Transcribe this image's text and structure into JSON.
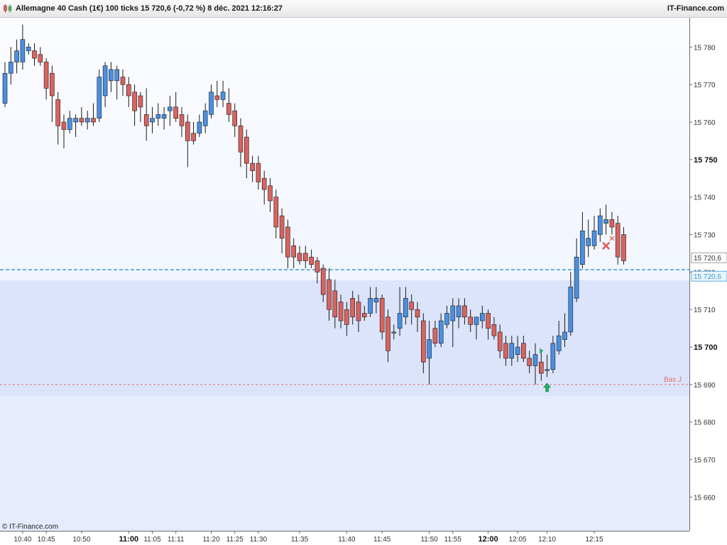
{
  "header": {
    "title": "Allemagne 40 Cash (1€) 100 ticks 15 720,6 (-0,72 %) 8 déc. 2021 12:16:27",
    "brand": "IT-Finance.com",
    "credit": "© IT-Finance.com"
  },
  "colors": {
    "up": "#4a90e2",
    "down": "#d9635f",
    "price_line": "#3a9ad9",
    "bas_j": "#e07070",
    "signal_buy": "#27ae60",
    "signal_exit": "#e05555"
  },
  "chart_data": {
    "type": "candlestick",
    "ylim": [
      15651,
      15788
    ],
    "y_ticks": [
      15660,
      15670,
      15680,
      15690,
      15700,
      15710,
      15720,
      15730,
      15740,
      15750,
      15760,
      15770,
      15780
    ],
    "y_tick_labels": [
      "15 660",
      "15 670",
      "15 680",
      "15 690",
      "15 700",
      "15 710",
      "15 720",
      "15 730",
      "15 740",
      "15 750",
      "15 760",
      "15 770",
      "15 780"
    ],
    "y_bold_ticks": [
      15700,
      15750
    ],
    "last_price": 15720.6,
    "last_price_label": "15 720,6",
    "bas_j": 15690,
    "bas_j_label": "Bas J",
    "x_labels": [
      {
        "label": "10:40",
        "bar": 3
      },
      {
        "label": "10:45",
        "bar": 7
      },
      {
        "label": "10:50",
        "bar": 13
      },
      {
        "label": "11:00",
        "bar": 21,
        "bold": true
      },
      {
        "label": "11:05",
        "bar": 25
      },
      {
        "label": "11:11",
        "bar": 29
      },
      {
        "label": "11:20",
        "bar": 35
      },
      {
        "label": "11:25",
        "bar": 39
      },
      {
        "label": "11:30",
        "bar": 43
      },
      {
        "label": "11:35",
        "bar": 50
      },
      {
        "label": "11:40",
        "bar": 58
      },
      {
        "label": "11:45",
        "bar": 64
      },
      {
        "label": "11:50",
        "bar": 72
      },
      {
        "label": "11:55",
        "bar": 76
      },
      {
        "label": "12:00",
        "bar": 82,
        "bold": true
      },
      {
        "label": "12:05",
        "bar": 87
      },
      {
        "label": "12:10",
        "bar": 92
      },
      {
        "label": "12:15",
        "bar": 100
      }
    ],
    "candles": [
      {
        "o": 15765,
        "h": 15776,
        "l": 15764,
        "c": 15773
      },
      {
        "o": 15773,
        "h": 15780,
        "l": 15770,
        "c": 15776
      },
      {
        "o": 15776,
        "h": 15782,
        "l": 15773,
        "c": 15779
      },
      {
        "o": 15776,
        "h": 15786,
        "l": 15774,
        "c": 15782
      },
      {
        "o": 15779,
        "h": 15781,
        "l": 15778,
        "c": 15780
      },
      {
        "o": 15779,
        "h": 15781,
        "l": 15775,
        "c": 15777
      },
      {
        "o": 15778,
        "h": 15780,
        "l": 15775,
        "c": 15776
      },
      {
        "o": 15776,
        "h": 15777,
        "l": 15766,
        "c": 15769
      },
      {
        "o": 15773,
        "h": 15775,
        "l": 15760,
        "c": 15767
      },
      {
        "o": 15766,
        "h": 15768,
        "l": 15754,
        "c": 15759
      },
      {
        "o": 15760,
        "h": 15762,
        "l": 15753,
        "c": 15758
      },
      {
        "o": 15758,
        "h": 15763,
        "l": 15757,
        "c": 15761
      },
      {
        "o": 15760,
        "h": 15762,
        "l": 15756,
        "c": 15761
      },
      {
        "o": 15761,
        "h": 15764,
        "l": 15759,
        "c": 15760
      },
      {
        "o": 15760,
        "h": 15763,
        "l": 15758,
        "c": 15761
      },
      {
        "o": 15761,
        "h": 15765,
        "l": 15759,
        "c": 15760
      },
      {
        "o": 15761,
        "h": 15774,
        "l": 15760,
        "c": 15772
      },
      {
        "o": 15767,
        "h": 15776,
        "l": 15764,
        "c": 15775
      },
      {
        "o": 15771,
        "h": 15776,
        "l": 15768,
        "c": 15774
      },
      {
        "o": 15771,
        "h": 15775,
        "l": 15766,
        "c": 15774
      },
      {
        "o": 15772,
        "h": 15774,
        "l": 15767,
        "c": 15770
      },
      {
        "o": 15770,
        "h": 15772,
        "l": 15764,
        "c": 15767
      },
      {
        "o": 15768,
        "h": 15770,
        "l": 15759,
        "c": 15763
      },
      {
        "o": 15767,
        "h": 15768,
        "l": 15760,
        "c": 15764
      },
      {
        "o": 15762,
        "h": 15769,
        "l": 15755,
        "c": 15759
      },
      {
        "o": 15760,
        "h": 15764,
        "l": 15757,
        "c": 15761
      },
      {
        "o": 15761,
        "h": 15765,
        "l": 15759,
        "c": 15762
      },
      {
        "o": 15761,
        "h": 15764,
        "l": 15758,
        "c": 15762
      },
      {
        "o": 15763,
        "h": 15767,
        "l": 15759,
        "c": 15764
      },
      {
        "o": 15764,
        "h": 15768,
        "l": 15760,
        "c": 15761
      },
      {
        "o": 15762,
        "h": 15764,
        "l": 15756,
        "c": 15759
      },
      {
        "o": 15760,
        "h": 15762,
        "l": 15748,
        "c": 15755
      },
      {
        "o": 15757,
        "h": 15760,
        "l": 15754,
        "c": 15755
      },
      {
        "o": 15757,
        "h": 15762,
        "l": 15756,
        "c": 15760
      },
      {
        "o": 15759,
        "h": 15765,
        "l": 15757,
        "c": 15763
      },
      {
        "o": 15762,
        "h": 15770,
        "l": 15761,
        "c": 15768
      },
      {
        "o": 15767,
        "h": 15771,
        "l": 15764,
        "c": 15766
      },
      {
        "o": 15766,
        "h": 15771,
        "l": 15764,
        "c": 15768
      },
      {
        "o": 15765,
        "h": 15769,
        "l": 15760,
        "c": 15762
      },
      {
        "o": 15763,
        "h": 15765,
        "l": 15756,
        "c": 15759
      },
      {
        "o": 15759,
        "h": 15761,
        "l": 15748,
        "c": 15752
      },
      {
        "o": 15756,
        "h": 15758,
        "l": 15745,
        "c": 15749
      },
      {
        "o": 15749,
        "h": 15751,
        "l": 15744,
        "c": 15747
      },
      {
        "o": 15749,
        "h": 15751,
        "l": 15742,
        "c": 15744
      },
      {
        "o": 15745,
        "h": 15747,
        "l": 15738,
        "c": 15742
      },
      {
        "o": 15743,
        "h": 15745,
        "l": 15736,
        "c": 15739
      },
      {
        "o": 15740,
        "h": 15742,
        "l": 15729,
        "c": 15732
      },
      {
        "o": 15735,
        "h": 15737,
        "l": 15725,
        "c": 15729
      },
      {
        "o": 15732,
        "h": 15734,
        "l": 15721,
        "c": 15724
      },
      {
        "o": 15727,
        "h": 15729,
        "l": 15721,
        "c": 15724
      },
      {
        "o": 15725,
        "h": 15727,
        "l": 15722,
        "c": 15723
      },
      {
        "o": 15725,
        "h": 15727,
        "l": 15721,
        "c": 15723
      },
      {
        "o": 15724,
        "h": 15726,
        "l": 15721,
        "c": 15722
      },
      {
        "o": 15723,
        "h": 15724,
        "l": 15717,
        "c": 15720
      },
      {
        "o": 15721,
        "h": 15722,
        "l": 15712,
        "c": 15714
      },
      {
        "o": 15718,
        "h": 15721,
        "l": 15707,
        "c": 15710
      },
      {
        "o": 15715,
        "h": 15718,
        "l": 15705,
        "c": 15708
      },
      {
        "o": 15712,
        "h": 15714,
        "l": 15705,
        "c": 15707
      },
      {
        "o": 15710,
        "h": 15712,
        "l": 15703,
        "c": 15706
      },
      {
        "o": 15713,
        "h": 15715,
        "l": 15706,
        "c": 15708
      },
      {
        "o": 15712,
        "h": 15714,
        "l": 15704,
        "c": 15707
      },
      {
        "o": 15709,
        "h": 15711,
        "l": 15707,
        "c": 15708
      },
      {
        "o": 15709,
        "h": 15716,
        "l": 15708,
        "c": 15713
      },
      {
        "o": 15712,
        "h": 15716,
        "l": 15709,
        "c": 15713
      },
      {
        "o": 15713,
        "h": 15714,
        "l": 15702,
        "c": 15704
      },
      {
        "o": 15708,
        "h": 15710,
        "l": 15696,
        "c": 15699
      },
      {
        "o": 15704,
        "h": 15706,
        "l": 15702,
        "c": 15704
      },
      {
        "o": 15705,
        "h": 15716,
        "l": 15703,
        "c": 15709
      },
      {
        "o": 15708,
        "h": 15716,
        "l": 15706,
        "c": 15713
      },
      {
        "o": 15712,
        "h": 15714,
        "l": 15706,
        "c": 15710
      },
      {
        "o": 15710,
        "h": 15712,
        "l": 15704,
        "c": 15708
      },
      {
        "o": 15707,
        "h": 15709,
        "l": 15693,
        "c": 15696
      },
      {
        "o": 15697,
        "h": 15707,
        "l": 15690,
        "c": 15702
      },
      {
        "o": 15705,
        "h": 15707,
        "l": 15700,
        "c": 15701
      },
      {
        "o": 15701,
        "h": 15709,
        "l": 15700,
        "c": 15707
      },
      {
        "o": 15706,
        "h": 15711,
        "l": 15705,
        "c": 15709
      },
      {
        "o": 15707,
        "h": 15713,
        "l": 15700,
        "c": 15711
      },
      {
        "o": 15708,
        "h": 15713,
        "l": 15705,
        "c": 15711
      },
      {
        "o": 15711,
        "h": 15713,
        "l": 15706,
        "c": 15708
      },
      {
        "o": 15708,
        "h": 15710,
        "l": 15704,
        "c": 15706
      },
      {
        "o": 15706,
        "h": 15708,
        "l": 15702,
        "c": 15708
      },
      {
        "o": 15707,
        "h": 15711,
        "l": 15705,
        "c": 15709
      },
      {
        "o": 15709,
        "h": 15710,
        "l": 15702,
        "c": 15705
      },
      {
        "o": 15706,
        "h": 15708,
        "l": 15702,
        "c": 15703
      },
      {
        "o": 15704,
        "h": 15706,
        "l": 15697,
        "c": 15699
      },
      {
        "o": 15701,
        "h": 15703,
        "l": 15695,
        "c": 15697
      },
      {
        "o": 15697,
        "h": 15703,
        "l": 15695,
        "c": 15701
      },
      {
        "o": 15698,
        "h": 15703,
        "l": 15696,
        "c": 15700
      },
      {
        "o": 15701,
        "h": 15703,
        "l": 15696,
        "c": 15697
      },
      {
        "o": 15697,
        "h": 15699,
        "l": 15693,
        "c": 15695
      },
      {
        "o": 15695,
        "h": 15701,
        "l": 15690,
        "c": 15698
      },
      {
        "o": 15696,
        "h": 15699,
        "l": 15691,
        "c": 15693
      },
      {
        "o": 15694,
        "h": 15698,
        "l": 15692,
        "c": 15694
      },
      {
        "o": 15694,
        "h": 15703,
        "l": 15693,
        "c": 15701
      },
      {
        "o": 15699,
        "h": 15707,
        "l": 15698,
        "c": 15703
      },
      {
        "o": 15702,
        "h": 15709,
        "l": 15700,
        "c": 15704
      },
      {
        "o": 15704,
        "h": 15720,
        "l": 15703,
        "c": 15716
      },
      {
        "o": 15713,
        "h": 15729,
        "l": 15712,
        "c": 15724
      },
      {
        "o": 15722,
        "h": 15736,
        "l": 15721,
        "c": 15731
      },
      {
        "o": 15727,
        "h": 15734,
        "l": 15724,
        "c": 15729
      },
      {
        "o": 15727,
        "h": 15735,
        "l": 15726,
        "c": 15731
      },
      {
        "o": 15730,
        "h": 15737,
        "l": 15728,
        "c": 15735
      },
      {
        "o": 15733,
        "h": 15738,
        "l": 15730,
        "c": 15734
      },
      {
        "o": 15734,
        "h": 15736,
        "l": 15730,
        "c": 15732
      },
      {
        "o": 15733,
        "h": 15735,
        "l": 15722,
        "c": 15724
      },
      {
        "o": 15730,
        "h": 15732,
        "l": 15722,
        "c": 15723
      }
    ],
    "signals": [
      {
        "type": "buy-arrow",
        "bar": 92,
        "price": 15690
      },
      {
        "type": "entry-flag",
        "bar": 91,
        "price": 15699
      },
      {
        "type": "exit-cross",
        "bar": 102,
        "price": 15727
      },
      {
        "type": "exit-tick",
        "bar": 103,
        "price": 15729
      }
    ]
  }
}
